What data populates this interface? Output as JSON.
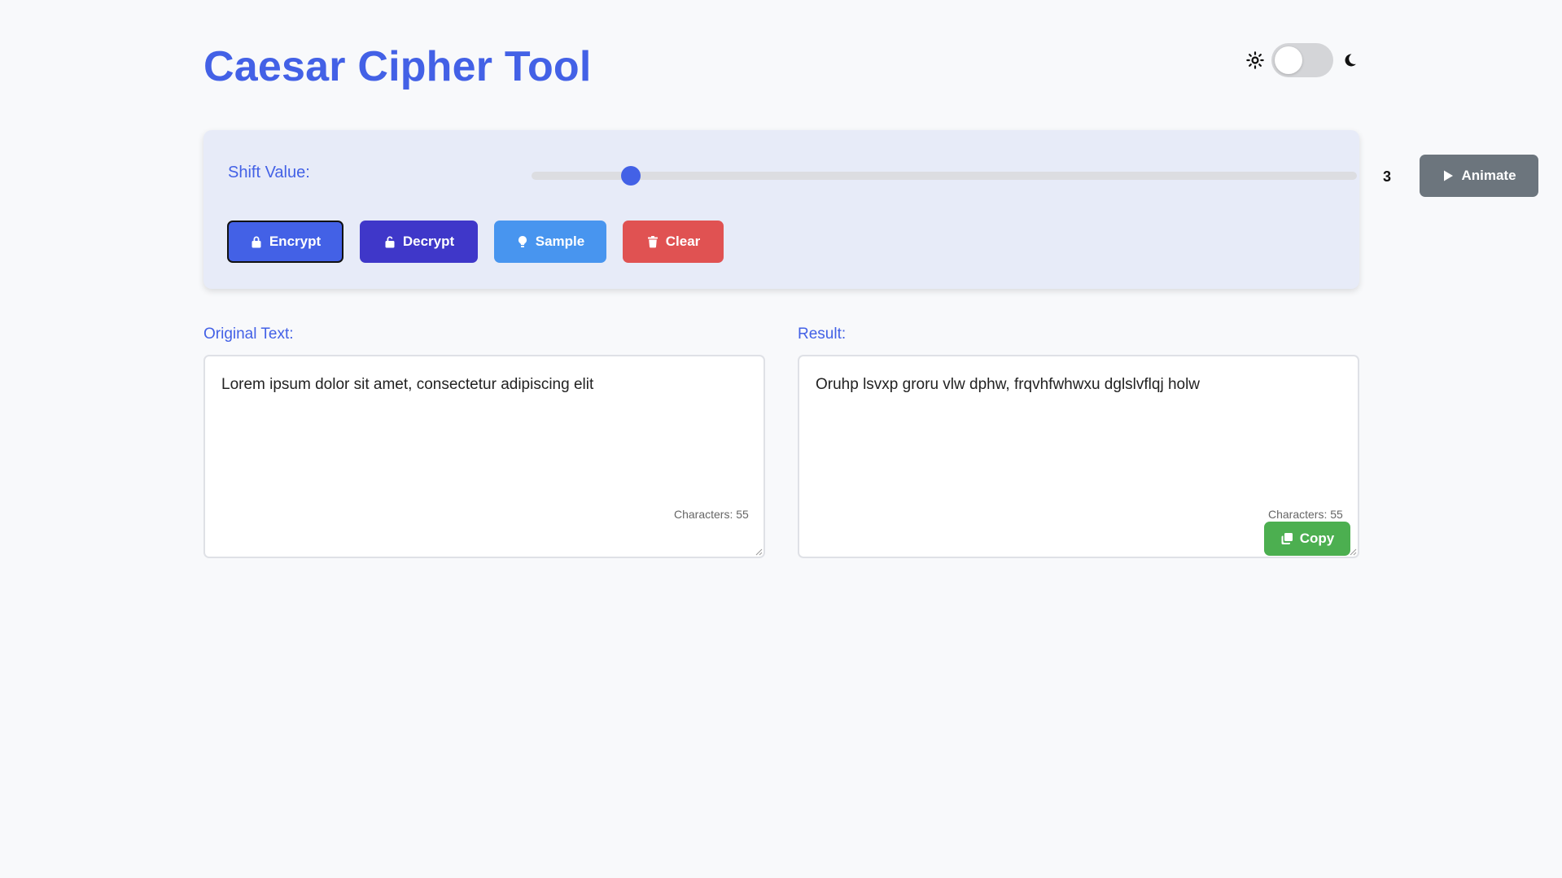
{
  "app": {
    "title": "Caesar Cipher Tool"
  },
  "theme": {
    "mode": "light",
    "sun_icon": "sun-icon",
    "moon_icon": "moon-icon"
  },
  "controls": {
    "shift_label": "Shift Value:",
    "shift_value": "3",
    "slider_fraction": 0.12,
    "animate_label": "Animate",
    "encrypt_label": "Encrypt",
    "decrypt_label": "Decrypt",
    "sample_label": "Sample",
    "clear_label": "Clear"
  },
  "original": {
    "label": "Original Text:",
    "text": "Lorem ipsum dolor sit amet, consectetur adipiscing elit",
    "char_count": "Characters: 55"
  },
  "result": {
    "label": "Result:",
    "text": "Oruhp lsvxp groru vlw dphw, frqvhfwhwxu dglslvflqj holw",
    "char_count": "Characters: 55",
    "copy_label": "Copy"
  },
  "colors": {
    "accent": "#4361e6",
    "decrypt": "#3f37c9",
    "sample": "#4895ef",
    "clear": "#e05252",
    "animate": "#6c757d",
    "copy": "#4caf50"
  }
}
